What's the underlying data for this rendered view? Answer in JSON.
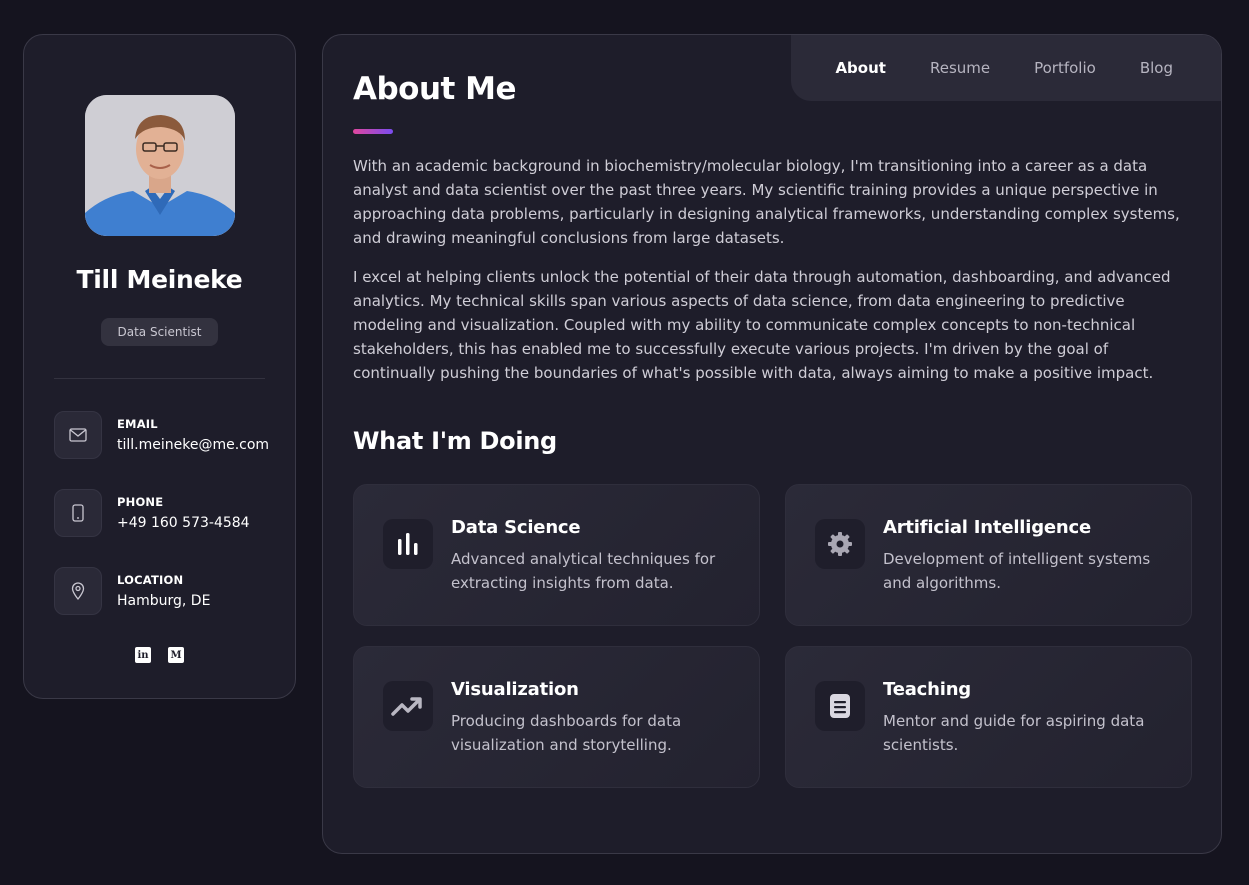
{
  "profile": {
    "name": "Till Meineke",
    "title": "Data Scientist"
  },
  "contacts": [
    {
      "label": "EMAIL",
      "value": "till.meineke@me.com",
      "icon": "mail-icon"
    },
    {
      "label": "PHONE",
      "value": "+49 160 573-4584",
      "icon": "phone-icon"
    },
    {
      "label": "LOCATION",
      "value": "Hamburg, DE",
      "icon": "location-pin-icon"
    }
  ],
  "socials": [
    {
      "name": "linkedin",
      "glyph": "in"
    },
    {
      "name": "medium",
      "glyph": "M"
    }
  ],
  "nav": {
    "items": [
      {
        "label": "About",
        "active": true
      },
      {
        "label": "Resume",
        "active": false
      },
      {
        "label": "Portfolio",
        "active": false
      },
      {
        "label": "Blog",
        "active": false
      }
    ]
  },
  "about": {
    "heading": "About Me",
    "paragraphs": [
      "With an academic background in biochemistry/molecular biology, I'm transitioning into a career as a data analyst and data scientist over the past three years. My scientific training provides a unique perspective in approaching data problems, particularly in designing analytical frameworks, understanding complex systems, and drawing meaningful conclusions from large datasets.",
      "I excel at helping clients unlock the potential of their data through automation, dashboarding, and advanced analytics. My technical skills span various aspects of data science, from data engineering to predictive modeling and visualization. Coupled with my ability to communicate complex concepts to non-technical stakeholders, this has enabled me to successfully execute various projects. I'm driven by the goal of continually pushing the boundaries of what's possible with data, always aiming to make a positive impact."
    ]
  },
  "services": {
    "heading": "What I'm Doing",
    "items": [
      {
        "title": "Data Science",
        "description": "Advanced analytical techniques for extracting insights from data.",
        "icon": "bar-chart-icon"
      },
      {
        "title": "Artificial Intelligence",
        "description": "Development of intelligent systems and algorithms.",
        "icon": "gear-icon"
      },
      {
        "title": "Visualization",
        "description": "Producing dashboards for data visualization and storytelling.",
        "icon": "trending-up-icon"
      },
      {
        "title": "Teaching",
        "description": "Mentor and guide for aspiring data scientists.",
        "icon": "notebook-icon"
      }
    ]
  },
  "colors": {
    "background": "#15141f",
    "panel": "#1e1d2a",
    "accent_start": "#e0479e",
    "accent_end": "#7a4cf0"
  }
}
